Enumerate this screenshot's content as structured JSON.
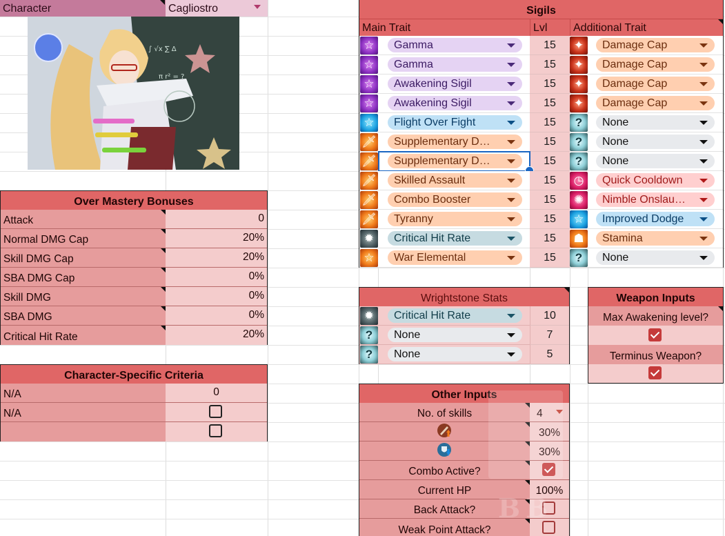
{
  "character": {
    "label": "Character",
    "selected": "Cagliostro",
    "portrait_alt": "Cagliostro character portrait"
  },
  "over_mastery": {
    "title": "Over Mastery Bonuses",
    "rows": [
      {
        "label": "Attack",
        "value": "0"
      },
      {
        "label": "Normal DMG Cap",
        "value": "20%"
      },
      {
        "label": "Skill DMG Cap",
        "value": "20%"
      },
      {
        "label": "SBA DMG Cap",
        "value": "0%"
      },
      {
        "label": "Skill DMG",
        "value": "0%"
      },
      {
        "label": "SBA DMG",
        "value": "0%"
      },
      {
        "label": "Critical Hit Rate",
        "value": "20%"
      }
    ]
  },
  "char_criteria": {
    "title": "Character-Specific Criteria",
    "rows": [
      {
        "label": "N/A",
        "value": "0",
        "type": "number"
      },
      {
        "label": "N/A",
        "checked": false,
        "type": "checkbox"
      },
      {
        "label": "",
        "checked": false,
        "type": "checkbox"
      }
    ]
  },
  "sigils": {
    "title": "Sigils",
    "col_main": "Main Trait",
    "col_lvl": "Lvl",
    "col_additional": "Additional Trait",
    "rows": [
      {
        "main_icon": "star-icon",
        "main_color": "purple",
        "main": "Gamma",
        "lvl": "15",
        "add_icon": "damage-cap-icon",
        "add_color": "orange",
        "add": "Damage Cap"
      },
      {
        "main_icon": "star-icon",
        "main_color": "purple",
        "main": "Gamma",
        "lvl": "15",
        "add_icon": "damage-cap-icon",
        "add_color": "orange",
        "add": "Damage Cap"
      },
      {
        "main_icon": "star-icon",
        "main_color": "purple",
        "main": "Awakening Sigil",
        "lvl": "15",
        "add_icon": "damage-cap-icon",
        "add_color": "orange",
        "add": "Damage Cap"
      },
      {
        "main_icon": "star-icon",
        "main_color": "purple",
        "main": "Awakening Sigil",
        "lvl": "15",
        "add_icon": "damage-cap-icon",
        "add_color": "orange",
        "add": "Damage Cap"
      },
      {
        "main_icon": "star-icon",
        "main_color": "blue",
        "main": "Flight Over Fight",
        "lvl": "15",
        "add_icon": "question-icon",
        "add_color": "gray",
        "add": "None"
      },
      {
        "main_icon": "sword-icon",
        "main_color": "orange",
        "main": "Supplementary D…",
        "lvl": "15",
        "add_icon": "question-icon",
        "add_color": "gray",
        "add": "None"
      },
      {
        "main_icon": "sword-icon",
        "main_color": "orange",
        "main": "Supplementary D…",
        "lvl": "15",
        "add_icon": "question-icon",
        "add_color": "gray",
        "add": "None",
        "selected": true
      },
      {
        "main_icon": "sword-icon",
        "main_color": "orange",
        "main": "Skilled Assault",
        "lvl": "15",
        "add_icon": "clock-icon",
        "add_color": "red",
        "add": "Quick Cooldown"
      },
      {
        "main_icon": "sword-icon",
        "main_color": "orange",
        "main": "Combo Booster",
        "lvl": "15",
        "add_icon": "burst-icon",
        "add_color": "red",
        "add": "Nimble Onslau…"
      },
      {
        "main_icon": "tyranny-icon",
        "main_color": "orange",
        "main": "Tyranny",
        "lvl": "15",
        "add_icon": "star-icon",
        "add_color": "blue",
        "add": "Improved Dodge"
      },
      {
        "main_icon": "critical-icon",
        "main_color": "teal",
        "main": "Critical Hit Rate",
        "lvl": "15",
        "add_icon": "stamina-icon",
        "add_color": "orange",
        "add": "Stamina"
      },
      {
        "main_icon": "star-icon",
        "main_color": "orange",
        "main": "War Elemental",
        "lvl": "15",
        "add_icon": "question-icon",
        "add_color": "gray",
        "add": "None"
      }
    ]
  },
  "wrightstone": {
    "title": "Wrightstone Stats",
    "rows": [
      {
        "icon": "critical-icon",
        "color": "teal",
        "trait": "Critical Hit Rate",
        "value": "10"
      },
      {
        "icon": "question-icon",
        "color": "gray",
        "trait": "None",
        "value": "7"
      },
      {
        "icon": "question-icon",
        "color": "gray",
        "trait": "None",
        "value": "5"
      }
    ]
  },
  "weapon_inputs": {
    "title": "Weapon Inputs",
    "max_awakening_label": "Max Awakening level?",
    "max_awakening_checked": true,
    "terminus_label": "Terminus Weapon?",
    "terminus_checked": true
  },
  "other_inputs": {
    "title": "Other Inputs",
    "skills_label": "No. of skills",
    "skills_value": "4",
    "atk_up_icon": "attack-up-icon",
    "atk_up_value": "30%",
    "def_down_icon": "defense-down-icon",
    "def_down_value": "30%",
    "combo_label": "Combo Active?",
    "combo_checked": true,
    "hp_label": "Current HP",
    "hp_value": "100%",
    "back_attack_label": "Back Attack?",
    "back_attack_checked": false,
    "weak_point_label": "Weak Point Attack?",
    "weak_point_checked": false
  },
  "glyphs": {
    "star": "☆",
    "sword": "🗡",
    "question": "?",
    "clock": "◷",
    "burst": "✺",
    "critical": "✹",
    "stamina": "☗",
    "damage": "✦"
  },
  "watermark": "BB"
}
